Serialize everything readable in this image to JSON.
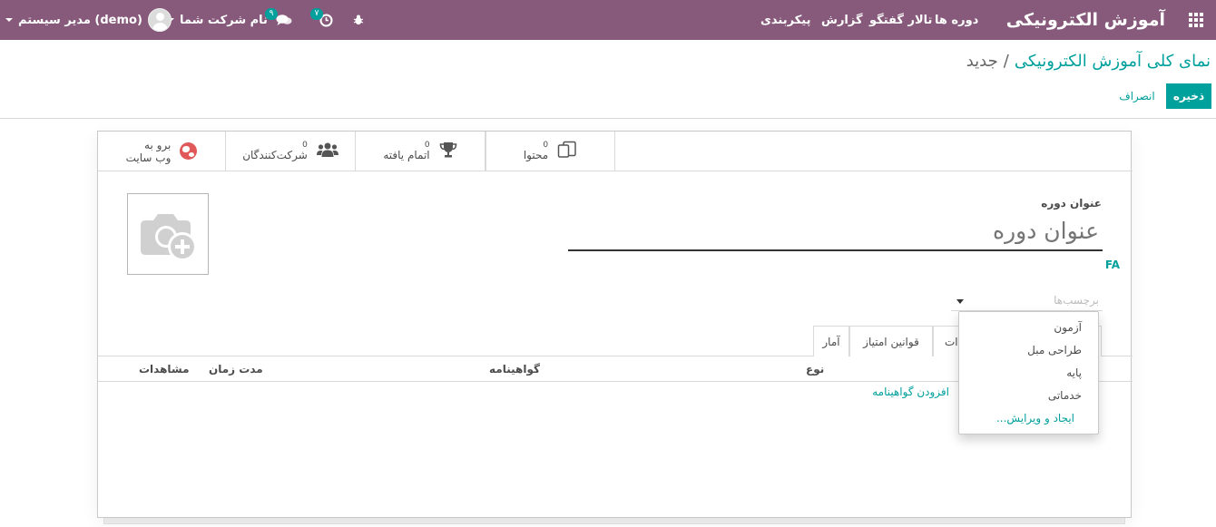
{
  "navbar": {
    "brand": "آموزش الکترونیکی",
    "menu": [
      "دوره ها",
      "تالار گفتگو",
      "گزارش",
      "پیکربندی"
    ],
    "company": "نام شرکت شما",
    "user": "مدیر سیستم (demo)",
    "messages_badge": "۹",
    "activities_badge": "۷",
    "icons": [
      "apps-icon",
      "bug-icon",
      "clock-icon",
      "chat-icon",
      "caret-down-icon"
    ]
  },
  "breadcrumb": {
    "parent": "نمای کلی آموزش الکترونیکی",
    "separator": "/",
    "current": "جدید"
  },
  "actions": {
    "save": "ذخیره",
    "discard": "انصراف"
  },
  "stat_buttons": [
    {
      "label": "محتوا",
      "value": "0",
      "icon": "copy-icon"
    },
    {
      "label": "اتمام یافته",
      "value": "0",
      "icon": "trophy-icon"
    },
    {
      "label": "شرکت‌کنندگان",
      "value": "0",
      "icon": "users-icon"
    },
    {
      "label_line1": "برو به",
      "label_line2": "وب سایت",
      "icon": "globe-icon"
    }
  ],
  "form": {
    "title_label": "عنوان دوره",
    "title_placeholder": "عنوان دوره",
    "lang": "FA",
    "tags_placeholder": "برچسب‌ها"
  },
  "tabs": [
    "آمار",
    "قوانین امتیاز",
    "ات"
  ],
  "table": {
    "headers": {
      "views": "مشاهدات",
      "duration": "مدت زمان",
      "certificate": "گواهینامه",
      "type": "نوع"
    },
    "add_line": "افزودن گواهینامه"
  },
  "dropdown": {
    "items": [
      "آزمون",
      "طراحی مبل",
      "پایه",
      "خدماتی"
    ],
    "create": "ایجاد و ویرایش..."
  },
  "colors": {
    "navbar": "#875a7b",
    "accent": "#00a09d",
    "website_icon": "#e05858"
  }
}
